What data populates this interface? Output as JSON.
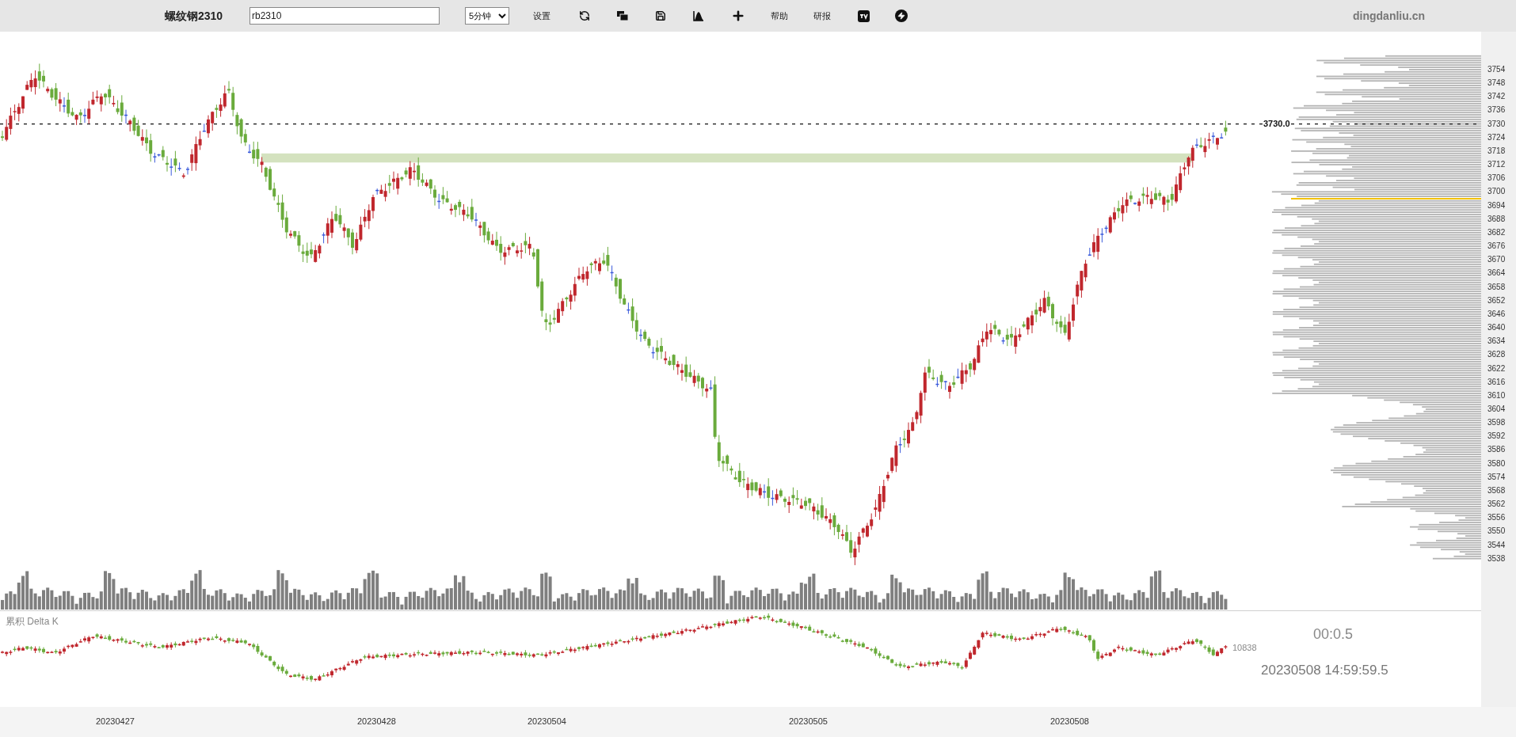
{
  "toolbar": {
    "title": "螺纹钢2310",
    "symbol": "rb2310",
    "interval": "5分钟",
    "settings_button": "设置",
    "help_button": "帮助",
    "research_button": "研报",
    "site_name": "dingdanliu.cn"
  },
  "price_axis": {
    "ticks": [
      "3754",
      "3748",
      "3742",
      "3736",
      "3730",
      "3724",
      "3718",
      "3712",
      "3706",
      "3700",
      "3694",
      "3688",
      "3682",
      "3676",
      "3670",
      "3664",
      "3658",
      "3652",
      "3646",
      "3640",
      "3634",
      "3628",
      "3622",
      "3616",
      "3610",
      "3604",
      "3598",
      "3592",
      "3586",
      "3580",
      "3574",
      "3568",
      "3562",
      "3556",
      "3550",
      "3544",
      "3538"
    ],
    "current_price": "3730.0"
  },
  "delta_panel": {
    "label": "累积 Delta K",
    "last_value": "10838",
    "timer": "00:0.5",
    "timestamp": "20230508 14:59:59.5"
  },
  "date_axis": [
    "20230427",
    "20230428",
    "20230504",
    "20230505",
    "20230508"
  ]
}
